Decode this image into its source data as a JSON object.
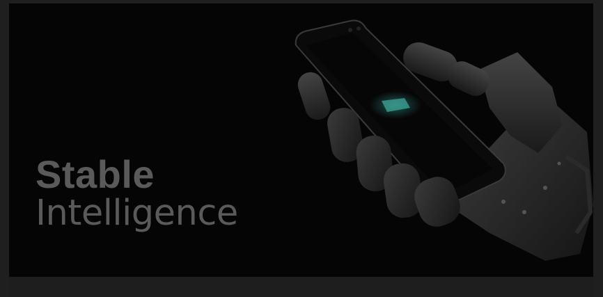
{
  "hero": {
    "title_line1": "Stable",
    "title_line2": "Intelligence",
    "image": "robot-hand-holding-smartphone",
    "phone_logo_icon": "stability-logo-icon"
  },
  "colors": {
    "background": "#050505",
    "title_text": "#5a5a5a",
    "phone_logo": "#3ea79a",
    "frame": "#1f1f1f"
  }
}
